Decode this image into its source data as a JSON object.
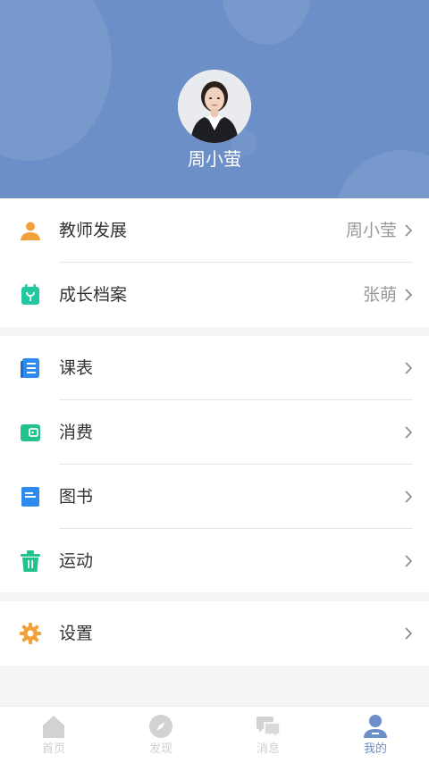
{
  "profile": {
    "name": "周小萤"
  },
  "colors": {
    "header_bg": "#6b8fc6",
    "accent": "#6b8fc6",
    "orange": "#f2a13a",
    "teal": "#21c8a0",
    "blue": "#2e8cf0",
    "green": "#21c38a"
  },
  "menu": {
    "group1": [
      {
        "label": "教师发展",
        "value": "周小莹",
        "icon": "person-icon"
      },
      {
        "label": "成长档案",
        "value": "张萌",
        "icon": "calendar-sprout-icon"
      }
    ],
    "group2": [
      {
        "label": "课表",
        "icon": "schedule-book-icon"
      },
      {
        "label": "消费",
        "icon": "wallet-icon"
      },
      {
        "label": "图书",
        "icon": "book-icon"
      },
      {
        "label": "运动",
        "icon": "trash-bin-icon"
      }
    ],
    "group3": [
      {
        "label": "设置",
        "icon": "gear-icon"
      }
    ]
  },
  "tabbar": [
    {
      "label": "首页",
      "icon": "home-icon",
      "active": false
    },
    {
      "label": "发现",
      "icon": "compass-icon",
      "active": false
    },
    {
      "label": "消息",
      "icon": "chat-bubbles-icon",
      "active": false
    },
    {
      "label": "我的",
      "icon": "user-icon",
      "active": true
    }
  ]
}
